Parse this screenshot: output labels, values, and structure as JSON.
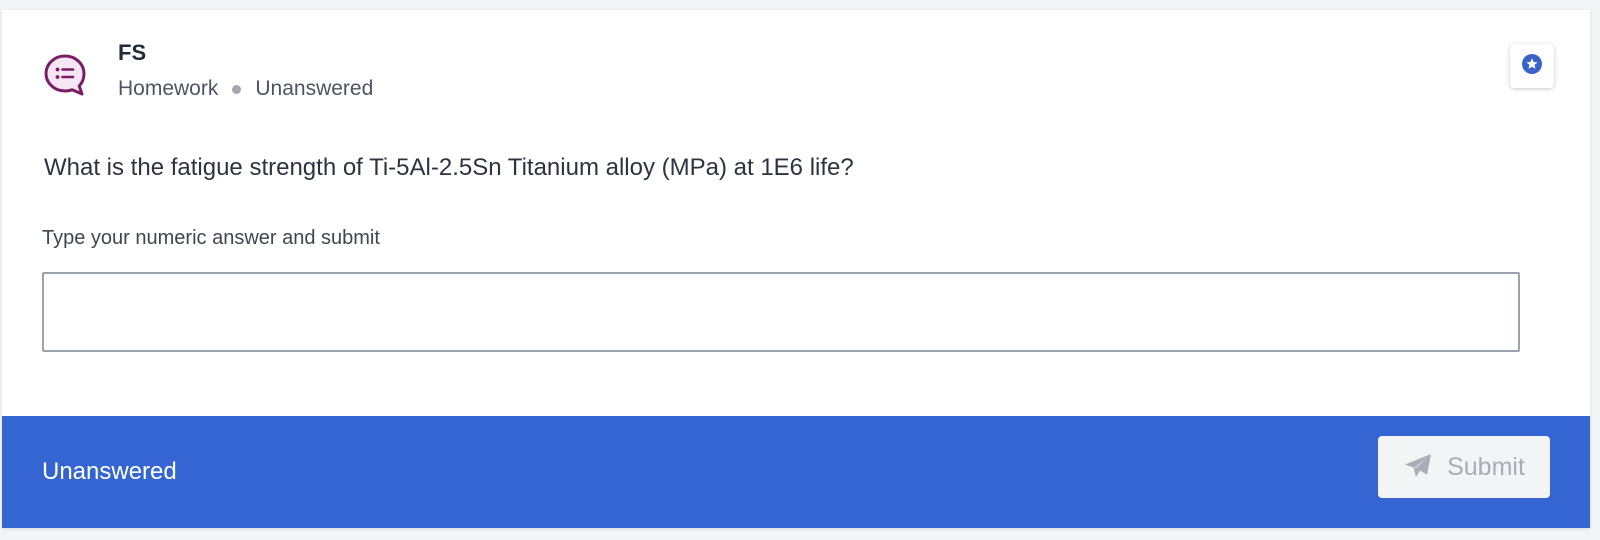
{
  "header": {
    "title": "FS",
    "category": "Homework",
    "status": "Unanswered",
    "avatar_icon": "chat-list-icon",
    "star_icon": "star-icon"
  },
  "question": {
    "text": "What is the fatigue strength of Ti-5Al-2.5Sn Titanium alloy (MPa) at 1E6 life?"
  },
  "answer": {
    "prompt": "Type your numeric answer and submit",
    "value": "",
    "placeholder": ""
  },
  "footer": {
    "status": "Unanswered",
    "submit_label": "Submit",
    "submit_icon": "paper-plane-icon"
  },
  "colors": {
    "accent": "#3465d2",
    "avatar": "#7a1d66",
    "star_badge": "#3a63c8"
  }
}
